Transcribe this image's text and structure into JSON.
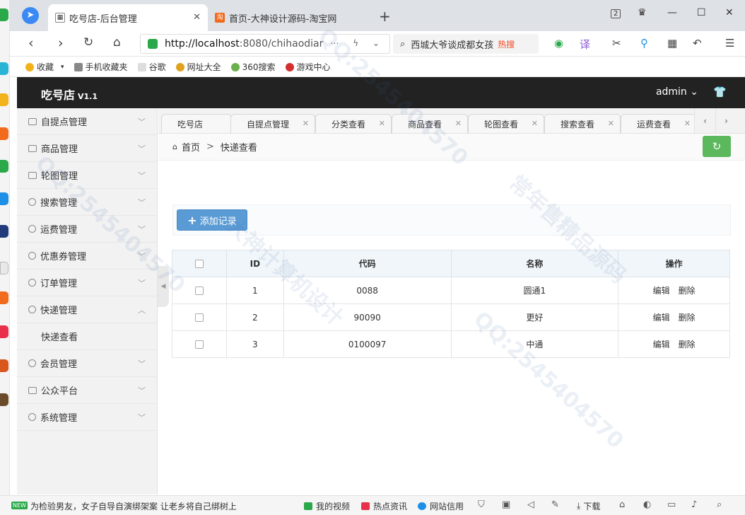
{
  "browser": {
    "tabs": [
      {
        "title": "吃号店-后台管理",
        "active": true
      },
      {
        "title": "首页-大神设计源码-淘宝网",
        "active": false
      }
    ],
    "tab_count_badge": "2",
    "url": {
      "host": "http://localhost",
      "rest": ":8080/chihaodiar"
    },
    "search": {
      "text": "西城大爷谈成都女孩",
      "badge": "热搜"
    },
    "bookmarks": [
      "收藏",
      "手机收藏夹",
      "谷歌",
      "网址大全",
      "360搜索",
      "游戏中心"
    ]
  },
  "app": {
    "logo": "吃号店",
    "version": "V1.1",
    "user": "admin"
  },
  "sidebar": {
    "items": [
      {
        "label": "自提点管理",
        "icon": "grid-icon",
        "expanded": false
      },
      {
        "label": "商品管理",
        "icon": "image-icon",
        "expanded": false
      },
      {
        "label": "轮图管理",
        "icon": "lock-icon",
        "expanded": false
      },
      {
        "label": "搜索管理",
        "icon": "chat-icon",
        "expanded": false
      },
      {
        "label": "运费管理",
        "icon": "chat-icon",
        "expanded": false
      },
      {
        "label": "优惠券管理",
        "icon": "chat-icon",
        "expanded": false
      },
      {
        "label": "订单管理",
        "icon": "chat-icon",
        "expanded": false
      },
      {
        "label": "快递管理",
        "icon": "chat-icon",
        "expanded": true
      },
      {
        "label": "会员管理",
        "icon": "chat-icon",
        "expanded": false
      },
      {
        "label": "公众平台",
        "icon": "grid-icon",
        "expanded": false
      },
      {
        "label": "系统管理",
        "icon": "chat-icon",
        "expanded": false
      }
    ],
    "sub_item": "快递查看"
  },
  "page_tabs": [
    {
      "label": "吃号店",
      "closable": false
    },
    {
      "label": "自提点管理",
      "closable": true
    },
    {
      "label": "分类查看",
      "closable": true
    },
    {
      "label": "商品查看",
      "closable": true
    },
    {
      "label": "轮图查看",
      "closable": true
    },
    {
      "label": "搜索查看",
      "closable": true
    },
    {
      "label": "运费查看",
      "closable": true
    }
  ],
  "breadcrumb": {
    "home": "首页",
    "sep": ">",
    "current": "快递查看"
  },
  "toolbar": {
    "add_label": "添加记录"
  },
  "table": {
    "headers": [
      "ID",
      "代码",
      "名称",
      "操作"
    ],
    "rows": [
      {
        "id": "1",
        "code": "0088",
        "name": "圆通1"
      },
      {
        "id": "2",
        "code": "90090",
        "name": "更好"
      },
      {
        "id": "3",
        "code": "0100097",
        "name": "中通"
      }
    ],
    "actions": {
      "edit": "编辑",
      "delete": "删除"
    }
  },
  "statusbar": {
    "news_badge": "NEW",
    "news": "为检验男友，女子自导自演绑架案 让老乡将自己绑树上",
    "items": [
      "我的视频",
      "热点资讯",
      "网站信用",
      "下载"
    ]
  },
  "watermark": [
    "QQ:2545404570",
    "大神计算机设计",
    "常年售精品源码"
  ],
  "colors": {
    "header": "#222222",
    "sidebar": "#f2f2f2",
    "add_button": "#5b9bd5",
    "refresh_button": "#5cb85c"
  }
}
